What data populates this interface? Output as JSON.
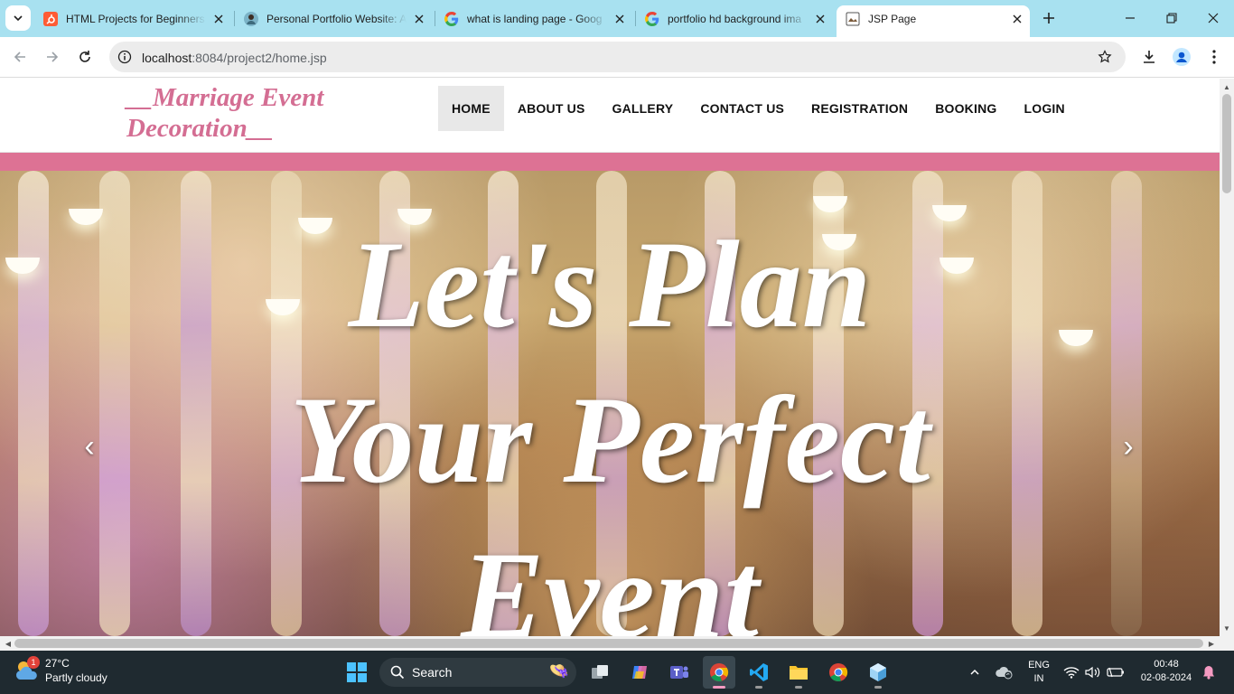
{
  "browser": {
    "tabs": [
      {
        "title": "HTML Projects for Beginners",
        "icon": "hubspot-icon",
        "active": false
      },
      {
        "title": "Personal Portfolio Website: A",
        "icon": "portfolio-site-icon",
        "active": false
      },
      {
        "title": "what is landing page - Goog",
        "icon": "google-icon",
        "active": false
      },
      {
        "title": "portfolio hd background ima",
        "icon": "google-icon",
        "active": false
      },
      {
        "title": "JSP Page",
        "icon": "page-icon",
        "active": true
      }
    ],
    "url_host": "localhost",
    "url_rest": ":8084/project2/home.jsp"
  },
  "site": {
    "brand_line1": "__Marriage Event",
    "brand_line2": "Decoration__",
    "menu": [
      "HOME",
      "ABOUT US",
      "GALLERY",
      "CONTACT US",
      "REGISTRATION",
      "BOOKING",
      "LOGIN"
    ],
    "active_menu": "HOME",
    "hero_line1": "Let's Plan",
    "hero_line2": "Your Perfect",
    "hero_line3": "Event",
    "prev_arrow": "‹",
    "next_arrow": "›",
    "accent_color": "#dd7294"
  },
  "taskbar": {
    "weather_badge": "1",
    "temperature": "27°C",
    "weather_desc": "Partly cloudy",
    "search_label": "Search",
    "lang_line1": "ENG",
    "lang_line2": "IN",
    "time": "00:48",
    "date": "02-08-2024"
  }
}
